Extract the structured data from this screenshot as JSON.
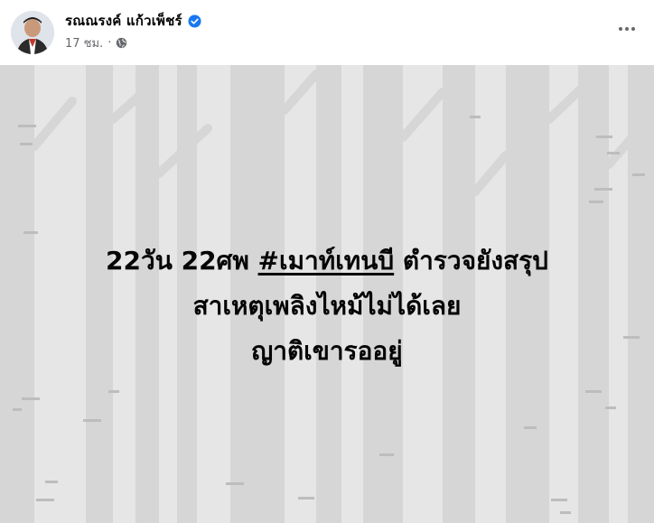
{
  "author": {
    "name": "รณณรงค์ แก้วเพ็ชร์",
    "verified": true,
    "avatar_icon": "profile-photo-icon"
  },
  "meta": {
    "time": "17 ชม.",
    "separator": "·",
    "privacy_icon": "globe-icon"
  },
  "actions": {
    "more_icon": "more-options-icon"
  },
  "post": {
    "line1_prefix": "22วัน 22ศพ ",
    "hashtag": "#เมาท์เทนบี",
    "line1_suffix": " ตำรวจยังสรุป",
    "line2": "สาเหตุเพลิงไหม้ไม่ได้เลย",
    "line3": "ญาติเขารออยู่"
  },
  "colors": {
    "background": "#e6e6e6",
    "trees": "#d5d5d5",
    "verified_badge": "#1877f2",
    "text": "#050505",
    "meta_text": "#65676b"
  }
}
